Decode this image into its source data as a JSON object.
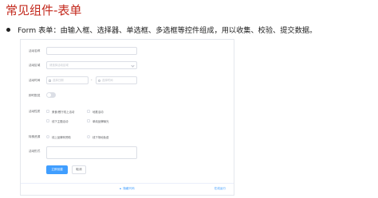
{
  "slide": {
    "title": "常见组件-表单",
    "bullet": "Form 表单：由输入框、选择器、单选框、多选框等控件组成，用以收集、校验、提交数据。"
  },
  "form": {
    "name_label": "活动名称",
    "region_label": "活动区域",
    "region_placeholder": "请选择活动区域",
    "time_label": "活动时间",
    "date_placeholder": "选择日期",
    "time_placeholder": "选择时间",
    "date_separator": "-",
    "delivery_label": "即时配送",
    "type_label": "活动性质",
    "type_options": [
      "美食/餐厅线上活动",
      "地推活动",
      "线下主题活动",
      "单纯品牌曝光"
    ],
    "resource_label": "特殊资源",
    "resource_options": [
      "线上品牌商赞助",
      "线下场地免费"
    ],
    "desc_label": "活动形式",
    "submit_label": "立即创建",
    "cancel_label": "取消"
  },
  "footer": {
    "hide_code": "隐藏代码",
    "online_run": "在线运行"
  },
  "colors": {
    "title_red": "#c3291d",
    "primary_blue": "#409eff"
  }
}
